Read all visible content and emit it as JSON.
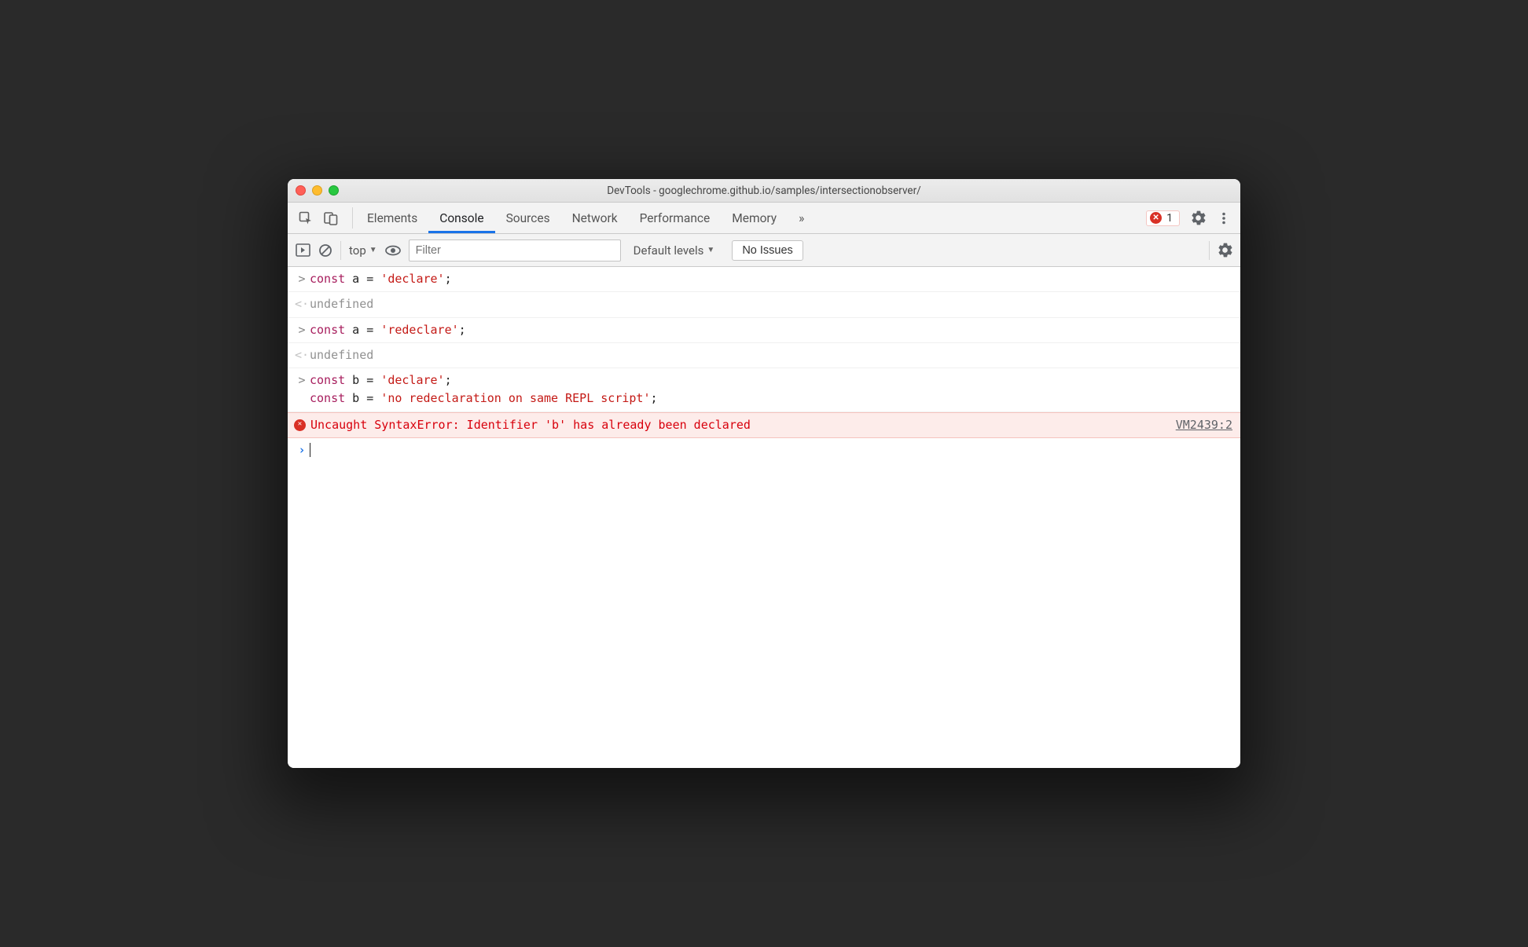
{
  "window": {
    "title": "DevTools - googlechrome.github.io/samples/intersectionobserver/"
  },
  "tabs": {
    "elements": "Elements",
    "console": "Console",
    "sources": "Sources",
    "network": "Network",
    "performance": "Performance",
    "memory": "Memory",
    "more": "»"
  },
  "errors": {
    "count": "1"
  },
  "toolbar": {
    "context": "top",
    "filter_placeholder": "Filter",
    "levels": "Default levels",
    "issues": "No Issues"
  },
  "console": {
    "rows": [
      {
        "g": ">",
        "code": [
          {
            "t": "kw",
            "v": "const"
          },
          {
            "t": "op",
            "v": " a "
          },
          {
            "t": "op",
            "v": "= "
          },
          {
            "t": "str",
            "v": "'declare'"
          },
          {
            "t": "op",
            "v": ";"
          }
        ]
      },
      {
        "g": "<·",
        "undef": "undefined"
      },
      {
        "g": ">",
        "code": [
          {
            "t": "kw",
            "v": "const"
          },
          {
            "t": "op",
            "v": " a "
          },
          {
            "t": "op",
            "v": "= "
          },
          {
            "t": "str",
            "v": "'redeclare'"
          },
          {
            "t": "op",
            "v": ";"
          }
        ]
      },
      {
        "g": "<·",
        "undef": "undefined"
      },
      {
        "g": ">",
        "code": [
          {
            "t": "kw",
            "v": "const"
          },
          {
            "t": "op",
            "v": " b "
          },
          {
            "t": "op",
            "v": "= "
          },
          {
            "t": "str",
            "v": "'declare'"
          },
          {
            "t": "op",
            "v": ";"
          },
          {
            "t": "br"
          },
          {
            "t": "kw",
            "v": "const"
          },
          {
            "t": "op",
            "v": " b "
          },
          {
            "t": "op",
            "v": "= "
          },
          {
            "t": "str",
            "v": "'no redeclaration on same REPL script'"
          },
          {
            "t": "op",
            "v": ";"
          }
        ]
      }
    ],
    "error": {
      "message": "Uncaught SyntaxError: Identifier 'b' has already been declared",
      "source": "VM2439:2"
    }
  }
}
